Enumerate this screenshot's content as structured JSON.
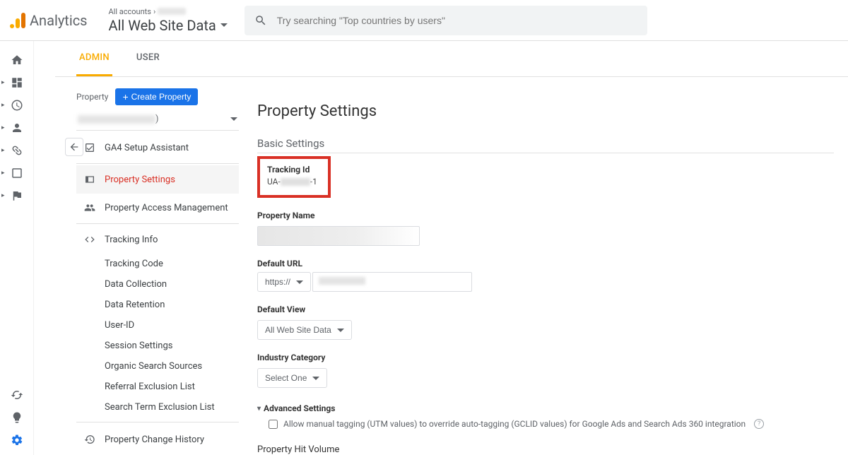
{
  "header": {
    "product": "Analytics",
    "breadcrumb_all": "All accounts",
    "breadcrumb_sep": "›",
    "view_selector": "All Web Site Data",
    "search_placeholder": "Try searching \"Top countries by users\""
  },
  "tabs": {
    "admin": "ADMIN",
    "user": "USER"
  },
  "property": {
    "label": "Property",
    "create_btn": "Create Property",
    "nav": {
      "ga4": "GA4 Setup Assistant",
      "settings": "Property Settings",
      "access": "Property Access Management",
      "tracking": "Tracking Info",
      "tracking_sub": [
        "Tracking Code",
        "Data Collection",
        "Data Retention",
        "User-ID",
        "Session Settings",
        "Organic Search Sources",
        "Referral Exclusion List",
        "Search Term Exclusion List"
      ],
      "history": "Property Change History"
    }
  },
  "settings": {
    "title": "Property Settings",
    "basic": "Basic Settings",
    "tracking_id_label": "Tracking Id",
    "tracking_id_prefix": "UA-",
    "tracking_id_suffix": "-1",
    "property_name_label": "Property Name",
    "default_url_label": "Default URL",
    "url_scheme": "https://",
    "default_view_label": "Default View",
    "default_view_value": "All Web Site Data",
    "industry_label": "Industry Category",
    "industry_value": "Select One",
    "advanced_label": "Advanced Settings",
    "manual_tagging": "Allow manual tagging (UTM values) to override auto-tagging (GCLID values) for Google Ads and Search Ads 360 integration",
    "phv_label": "Property Hit Volume"
  }
}
